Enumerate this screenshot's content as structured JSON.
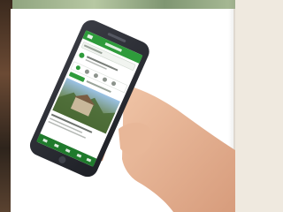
{
  "image": {
    "description_tags": [
      "hand-icon",
      "smartphone-icon"
    ]
  },
  "colors": {
    "app_green": "#2e9b3b",
    "app_green_dark": "#1f7a2c",
    "phone_body": "#2b2d33",
    "skin": "#e6b596",
    "background": "#efe9df"
  }
}
